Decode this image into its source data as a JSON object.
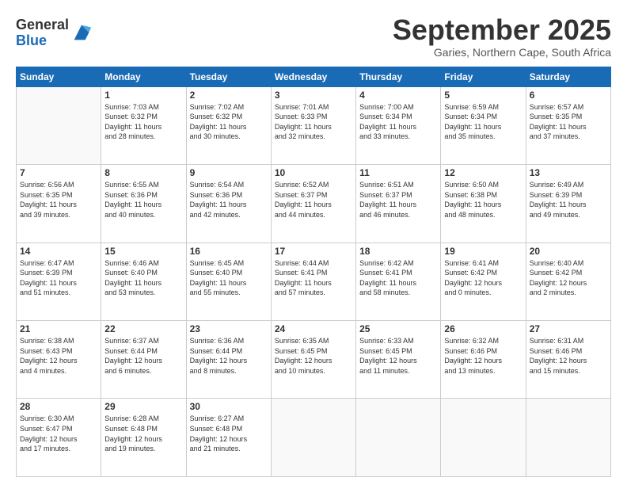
{
  "logo": {
    "general": "General",
    "blue": "Blue"
  },
  "header": {
    "month": "September 2025",
    "location": "Garies, Northern Cape, South Africa"
  },
  "days_of_week": [
    "Sunday",
    "Monday",
    "Tuesday",
    "Wednesday",
    "Thursday",
    "Friday",
    "Saturday"
  ],
  "weeks": [
    [
      {
        "day": "",
        "info": ""
      },
      {
        "day": "1",
        "info": "Sunrise: 7:03 AM\nSunset: 6:32 PM\nDaylight: 11 hours\nand 28 minutes."
      },
      {
        "day": "2",
        "info": "Sunrise: 7:02 AM\nSunset: 6:32 PM\nDaylight: 11 hours\nand 30 minutes."
      },
      {
        "day": "3",
        "info": "Sunrise: 7:01 AM\nSunset: 6:33 PM\nDaylight: 11 hours\nand 32 minutes."
      },
      {
        "day": "4",
        "info": "Sunrise: 7:00 AM\nSunset: 6:34 PM\nDaylight: 11 hours\nand 33 minutes."
      },
      {
        "day": "5",
        "info": "Sunrise: 6:59 AM\nSunset: 6:34 PM\nDaylight: 11 hours\nand 35 minutes."
      },
      {
        "day": "6",
        "info": "Sunrise: 6:57 AM\nSunset: 6:35 PM\nDaylight: 11 hours\nand 37 minutes."
      }
    ],
    [
      {
        "day": "7",
        "info": "Sunrise: 6:56 AM\nSunset: 6:35 PM\nDaylight: 11 hours\nand 39 minutes."
      },
      {
        "day": "8",
        "info": "Sunrise: 6:55 AM\nSunset: 6:36 PM\nDaylight: 11 hours\nand 40 minutes."
      },
      {
        "day": "9",
        "info": "Sunrise: 6:54 AM\nSunset: 6:36 PM\nDaylight: 11 hours\nand 42 minutes."
      },
      {
        "day": "10",
        "info": "Sunrise: 6:52 AM\nSunset: 6:37 PM\nDaylight: 11 hours\nand 44 minutes."
      },
      {
        "day": "11",
        "info": "Sunrise: 6:51 AM\nSunset: 6:37 PM\nDaylight: 11 hours\nand 46 minutes."
      },
      {
        "day": "12",
        "info": "Sunrise: 6:50 AM\nSunset: 6:38 PM\nDaylight: 11 hours\nand 48 minutes."
      },
      {
        "day": "13",
        "info": "Sunrise: 6:49 AM\nSunset: 6:39 PM\nDaylight: 11 hours\nand 49 minutes."
      }
    ],
    [
      {
        "day": "14",
        "info": "Sunrise: 6:47 AM\nSunset: 6:39 PM\nDaylight: 11 hours\nand 51 minutes."
      },
      {
        "day": "15",
        "info": "Sunrise: 6:46 AM\nSunset: 6:40 PM\nDaylight: 11 hours\nand 53 minutes."
      },
      {
        "day": "16",
        "info": "Sunrise: 6:45 AM\nSunset: 6:40 PM\nDaylight: 11 hours\nand 55 minutes."
      },
      {
        "day": "17",
        "info": "Sunrise: 6:44 AM\nSunset: 6:41 PM\nDaylight: 11 hours\nand 57 minutes."
      },
      {
        "day": "18",
        "info": "Sunrise: 6:42 AM\nSunset: 6:41 PM\nDaylight: 11 hours\nand 58 minutes."
      },
      {
        "day": "19",
        "info": "Sunrise: 6:41 AM\nSunset: 6:42 PM\nDaylight: 12 hours\nand 0 minutes."
      },
      {
        "day": "20",
        "info": "Sunrise: 6:40 AM\nSunset: 6:42 PM\nDaylight: 12 hours\nand 2 minutes."
      }
    ],
    [
      {
        "day": "21",
        "info": "Sunrise: 6:38 AM\nSunset: 6:43 PM\nDaylight: 12 hours\nand 4 minutes."
      },
      {
        "day": "22",
        "info": "Sunrise: 6:37 AM\nSunset: 6:44 PM\nDaylight: 12 hours\nand 6 minutes."
      },
      {
        "day": "23",
        "info": "Sunrise: 6:36 AM\nSunset: 6:44 PM\nDaylight: 12 hours\nand 8 minutes."
      },
      {
        "day": "24",
        "info": "Sunrise: 6:35 AM\nSunset: 6:45 PM\nDaylight: 12 hours\nand 10 minutes."
      },
      {
        "day": "25",
        "info": "Sunrise: 6:33 AM\nSunset: 6:45 PM\nDaylight: 12 hours\nand 11 minutes."
      },
      {
        "day": "26",
        "info": "Sunrise: 6:32 AM\nSunset: 6:46 PM\nDaylight: 12 hours\nand 13 minutes."
      },
      {
        "day": "27",
        "info": "Sunrise: 6:31 AM\nSunset: 6:46 PM\nDaylight: 12 hours\nand 15 minutes."
      }
    ],
    [
      {
        "day": "28",
        "info": "Sunrise: 6:30 AM\nSunset: 6:47 PM\nDaylight: 12 hours\nand 17 minutes."
      },
      {
        "day": "29",
        "info": "Sunrise: 6:28 AM\nSunset: 6:48 PM\nDaylight: 12 hours\nand 19 minutes."
      },
      {
        "day": "30",
        "info": "Sunrise: 6:27 AM\nSunset: 6:48 PM\nDaylight: 12 hours\nand 21 minutes."
      },
      {
        "day": "",
        "info": ""
      },
      {
        "day": "",
        "info": ""
      },
      {
        "day": "",
        "info": ""
      },
      {
        "day": "",
        "info": ""
      }
    ]
  ]
}
